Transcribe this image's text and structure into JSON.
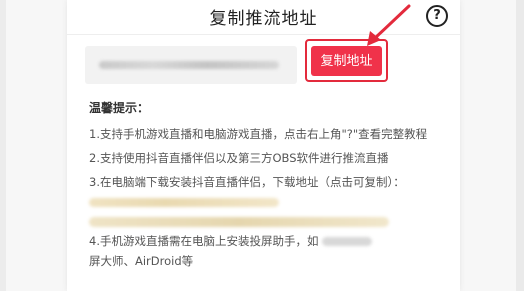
{
  "dialog": {
    "title": "复制推流地址",
    "help_label": "?"
  },
  "stream": {
    "copy_button_label": "复制地址"
  },
  "tips": {
    "title": "温馨提示：",
    "items": [
      "1.支持手机游戏直播和电脑游戏直播，点击右上角\"?\"查看完整教程",
      "2.支持使用抖音直播伴侣以及第三方OBS软件进行推流直播",
      "3.在电脑端下载安装抖音直播伴侣，下载地址（点击可复制）：",
      "4.手机游戏直播需在电脑上安装投屏助手，如",
      "屏大师、AirDroid等"
    ]
  },
  "colors": {
    "accent": "#f0324a",
    "highlight_border": "#e32a3c",
    "arrow": "#e32a3c"
  },
  "icons": {
    "help": "question-circle-icon",
    "annotation": "red-arrow-icon"
  }
}
